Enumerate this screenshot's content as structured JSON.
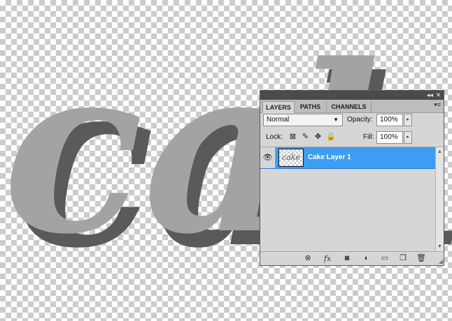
{
  "panel": {
    "titlebar": {
      "collapse_glyph": "◂◂",
      "close_glyph": "✕"
    },
    "tabs": [
      {
        "label": "LAYERS",
        "active": true
      },
      {
        "label": "PATHS",
        "active": false
      },
      {
        "label": "CHANNELS",
        "active": false
      }
    ],
    "tab_menu_glyph": "▾≡",
    "blend_mode": {
      "value": "Normal",
      "arrow": "▼"
    },
    "opacity": {
      "label": "Opacity:",
      "value": "100%",
      "stepper": "▸"
    },
    "lock": {
      "label": "Lock:",
      "icons": [
        "lock-transparent-icon",
        "lock-brush-icon",
        "lock-move-icon",
        "lock-all-icon"
      ]
    },
    "fill": {
      "label": "Fill:",
      "value": "100%",
      "stepper": "▸"
    },
    "layers": [
      {
        "name": "Cake Layer 1",
        "selected": true,
        "visible": true,
        "thumb_text": "cake"
      }
    ],
    "eye_glyph": "👁",
    "bottom_icons": [
      {
        "name": "link-layers-icon",
        "glyph": "⊗"
      },
      {
        "name": "fx-icon",
        "glyph": "fx"
      },
      {
        "name": "add-mask-icon",
        "glyph": "◙"
      },
      {
        "name": "adjustment-layer-icon",
        "glyph": "◐"
      },
      {
        "name": "new-group-icon",
        "glyph": "▭"
      },
      {
        "name": "new-layer-icon",
        "glyph": "❐"
      },
      {
        "name": "trash-icon",
        "glyph": "🗑"
      }
    ],
    "colors": {
      "selected_row": "#3d9df3",
      "panel_bg": "#d6d6d6"
    }
  },
  "canvas": {
    "art_text": "cake",
    "colors": {
      "fill": "#a3a3a3",
      "shadow": "#5a5a5a"
    }
  }
}
